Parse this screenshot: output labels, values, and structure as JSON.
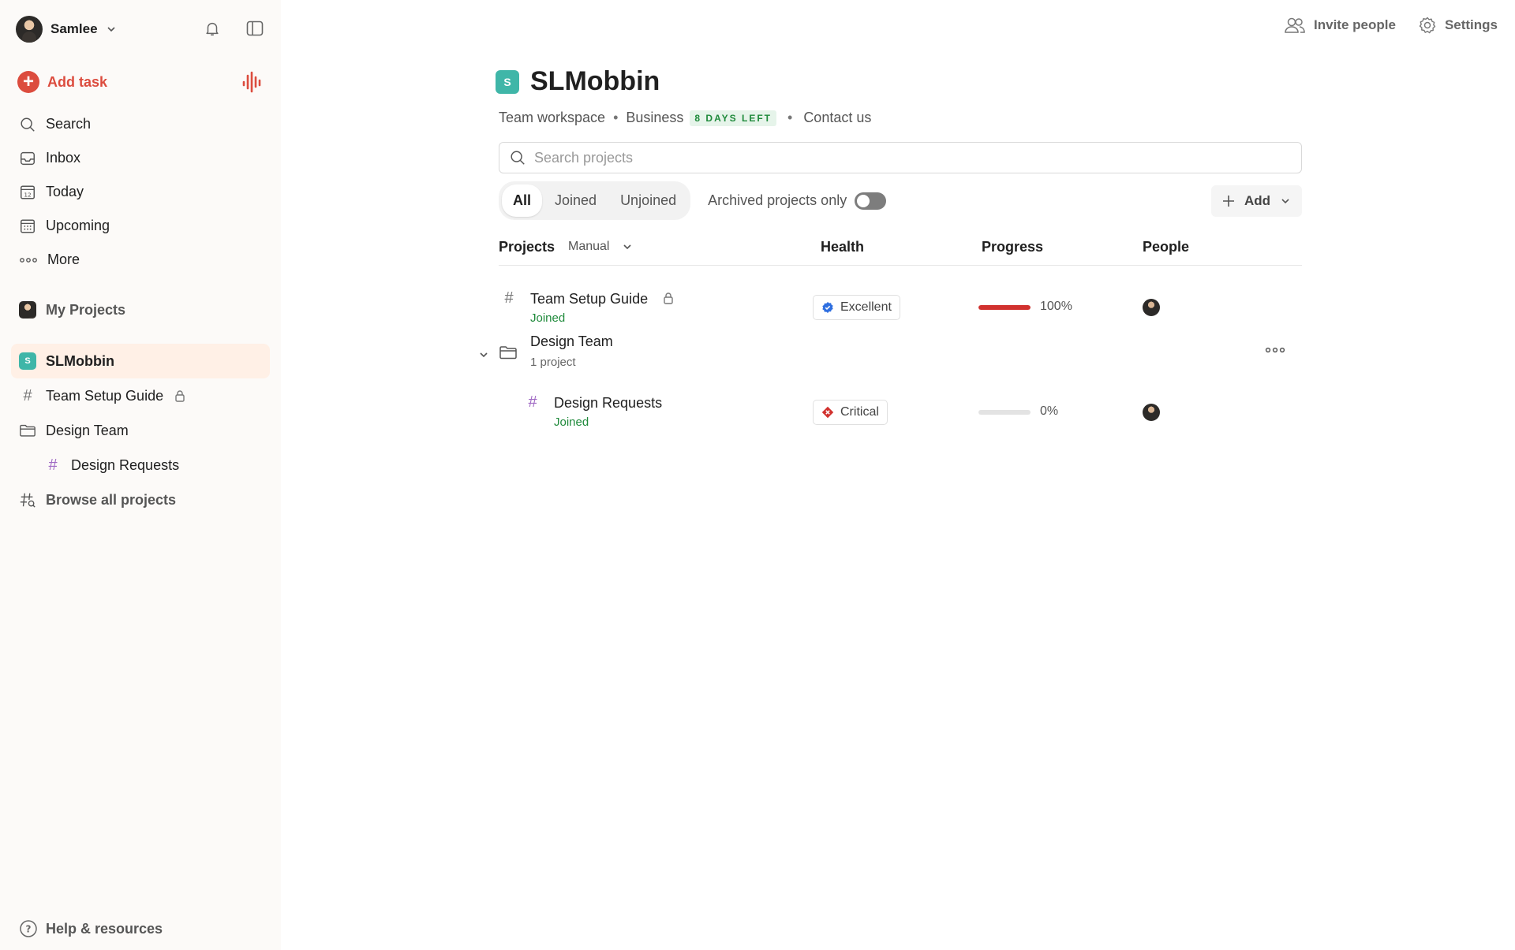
{
  "user": {
    "name": "Samlee"
  },
  "sidebar": {
    "add_task": "Add task",
    "nav": [
      {
        "label": "Search",
        "icon": "search-icon"
      },
      {
        "label": "Inbox",
        "icon": "inbox-icon"
      },
      {
        "label": "Today",
        "icon": "calendar-today-icon"
      },
      {
        "label": "Upcoming",
        "icon": "calendar-grid-icon"
      },
      {
        "label": "More",
        "icon": "more-dots-icon"
      }
    ],
    "my_projects": "My Projects",
    "workspace": {
      "badge": "S",
      "label": "SLMobbin"
    },
    "projects": [
      {
        "label": "Team Setup Guide"
      },
      {
        "label": "Design Team"
      },
      {
        "label": "Design Requests"
      }
    ],
    "browse": "Browse all projects",
    "help": "Help & resources"
  },
  "header": {
    "invite": "Invite people",
    "settings": "Settings"
  },
  "main": {
    "badge": "S",
    "title": "SLMobbin",
    "workspace_type": "Team workspace",
    "plan": "Business",
    "trial_badge": "8 DAYS LEFT",
    "contact": "Contact us",
    "search_placeholder": "Search projects",
    "tabs": [
      "All",
      "Joined",
      "Unjoined"
    ],
    "archived_label": "Archived projects only",
    "add_label": "Add",
    "columns": {
      "projects": "Projects",
      "sort": "Manual",
      "health": "Health",
      "progress": "Progress",
      "people": "People"
    },
    "rows": {
      "team_setup": {
        "name": "Team Setup Guide",
        "status": "Joined",
        "health": "Excellent",
        "progress": 1.0,
        "progress_label": "100%"
      },
      "design_team": {
        "name": "Design Team",
        "sub": "1 project"
      },
      "design_requests": {
        "name": "Design Requests",
        "status": "Joined",
        "health": "Critical",
        "progress": 0.0,
        "progress_label": "0%"
      }
    }
  },
  "colors": {
    "accent": "#dc4c3e",
    "workspace": "#3fb6a8",
    "joined": "#1f8a3b",
    "active_bg": "#fff0e6"
  }
}
